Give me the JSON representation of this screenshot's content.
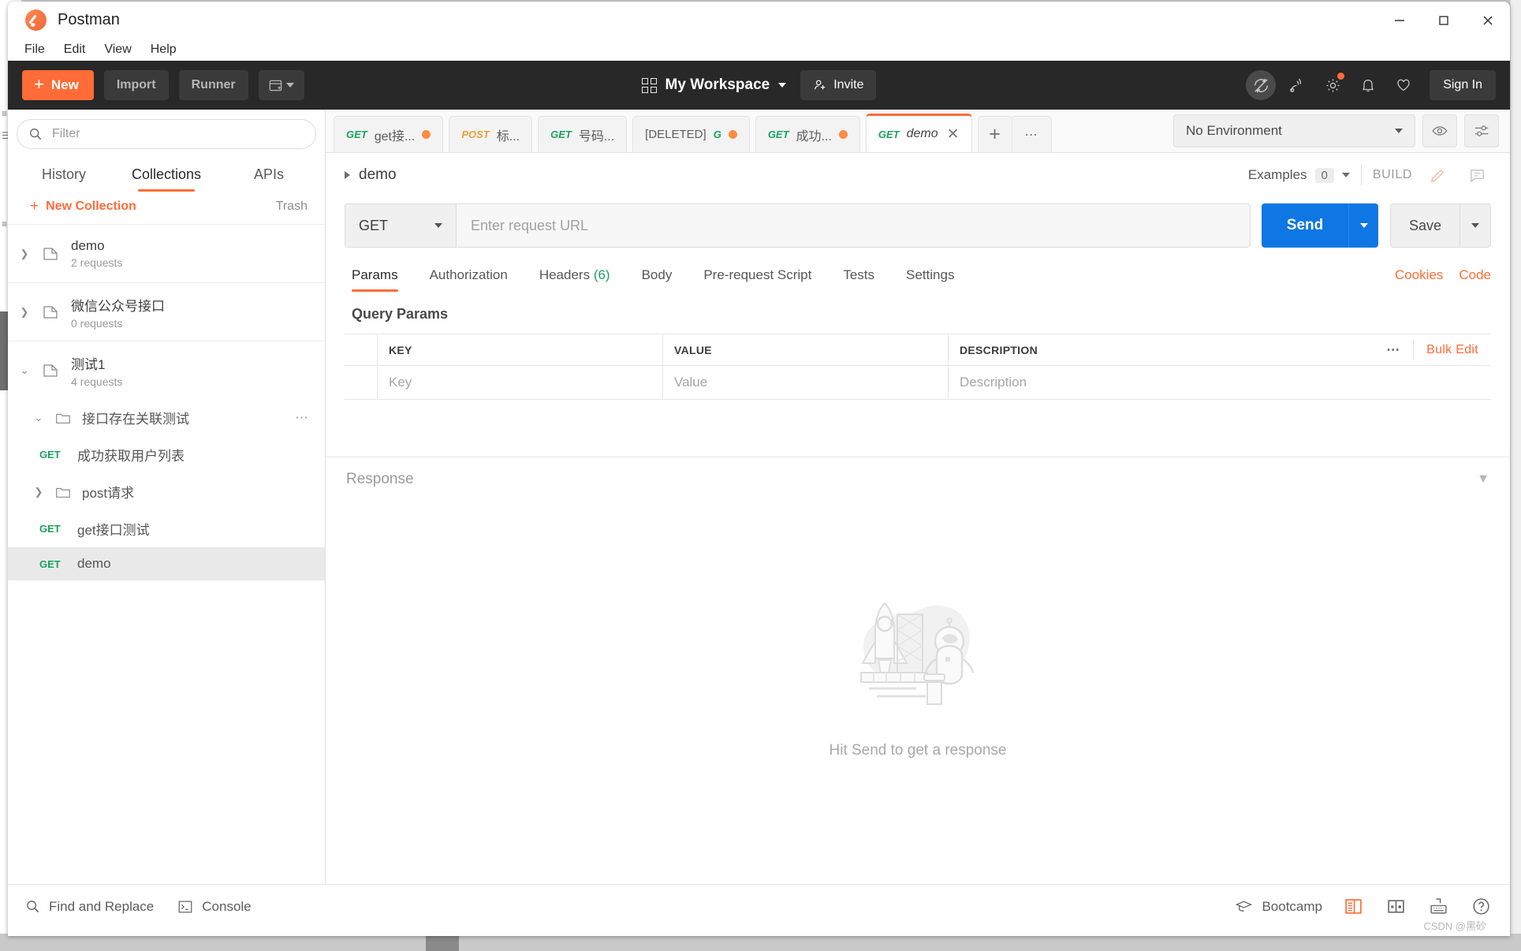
{
  "window": {
    "app_title": "Postman",
    "controls": {
      "minimize": "minimize-button",
      "maximize": "maximize-button",
      "close": "close-button"
    }
  },
  "menubar": {
    "items": [
      "File",
      "Edit",
      "View",
      "Help"
    ]
  },
  "toolbar": {
    "new_label": "New",
    "import_label": "Import",
    "runner_label": "Runner",
    "workspace_label": "My Workspace",
    "invite_label": "Invite",
    "signin_label": "Sign In",
    "accent_color": "#ff6c37",
    "bg_color": "#282828"
  },
  "sidebar": {
    "filter_placeholder": "Filter",
    "tabs": [
      {
        "label": "History",
        "active": false
      },
      {
        "label": "Collections",
        "active": true
      },
      {
        "label": "APIs",
        "active": false
      }
    ],
    "new_collection_label": "New Collection",
    "trash_label": "Trash",
    "collections": [
      {
        "name": "demo",
        "requests": "2 requests",
        "expanded": false
      },
      {
        "name": "微信公众号接口",
        "requests": "0 requests",
        "expanded": false
      },
      {
        "name": "测试1",
        "requests": "4 requests",
        "expanded": true
      }
    ],
    "tree": [
      {
        "type": "folder",
        "name": "接口存在关联测试",
        "expanded": true
      },
      {
        "type": "request",
        "method": "GET",
        "name": "成功获取用户列表",
        "selected": false
      },
      {
        "type": "folder",
        "name": "post请求",
        "expanded": false
      },
      {
        "type": "request",
        "method": "GET",
        "name": "get接口测试",
        "selected": false
      },
      {
        "type": "request",
        "method": "GET",
        "name": "demo",
        "selected": true
      }
    ]
  },
  "tabbar": {
    "tabs": [
      {
        "method": "GET",
        "title": "get接...",
        "unsaved": true,
        "active": false
      },
      {
        "method": "POST",
        "title": "标...",
        "unsaved": false,
        "active": false
      },
      {
        "method": "GET",
        "title": "号码...",
        "unsaved": false,
        "active": false
      },
      {
        "method": "[DELETED]",
        "title": "G",
        "unsaved": true,
        "active": false
      },
      {
        "method": "GET",
        "title": "成功...",
        "unsaved": true,
        "active": false
      },
      {
        "method": "GET",
        "title": "demo",
        "unsaved": false,
        "active": true
      }
    ],
    "environment": "No Environment"
  },
  "request": {
    "breadcrumb": "demo",
    "examples_label": "Examples",
    "examples_count": "0",
    "build_label": "BUILD",
    "method": "GET",
    "url_placeholder": "Enter request URL",
    "send_label": "Send",
    "save_label": "Save",
    "tabs": [
      {
        "label": "Params",
        "count": "",
        "active": true
      },
      {
        "label": "Authorization",
        "count": "",
        "active": false
      },
      {
        "label": "Headers",
        "count": "(6)",
        "active": false
      },
      {
        "label": "Body",
        "count": "",
        "active": false
      },
      {
        "label": "Pre-request Script",
        "count": "",
        "active": false
      },
      {
        "label": "Tests",
        "count": "",
        "active": false
      },
      {
        "label": "Settings",
        "count": "",
        "active": false
      }
    ],
    "cookies_label": "Cookies",
    "code_label": "Code",
    "query_params_title": "Query Params",
    "table": {
      "headers": [
        "KEY",
        "VALUE",
        "DESCRIPTION"
      ],
      "bulk_edit_label": "Bulk Edit",
      "row_placeholders": [
        "Key",
        "Value",
        "Description"
      ]
    }
  },
  "response": {
    "title": "Response",
    "empty_message": "Hit Send to get a response"
  },
  "statusbar": {
    "find_replace_label": "Find and Replace",
    "console_label": "Console",
    "bootcamp_label": "Bootcamp",
    "watermark": "CSDN @黑砂"
  }
}
